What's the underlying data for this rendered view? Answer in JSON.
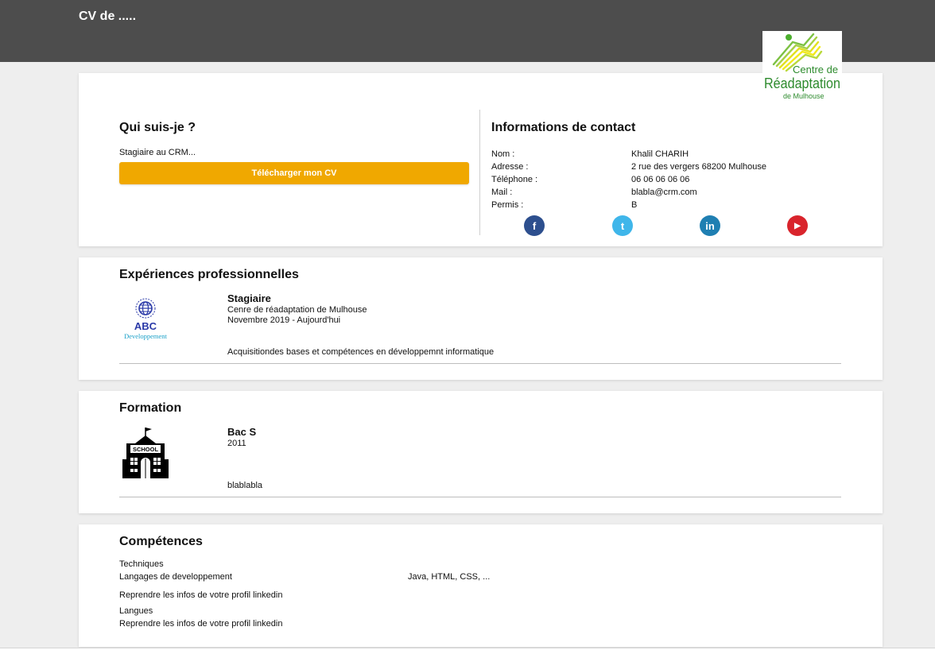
{
  "header": {
    "title": "CV de ....."
  },
  "logo": {
    "line1": "Centre de",
    "line2": "Réadaptation",
    "line3": "de Mulhouse"
  },
  "about": {
    "title": "Qui suis-je ?",
    "description": "Stagiaire au CRM...",
    "download_label": "Télécharger mon CV"
  },
  "contact": {
    "title": "Informations de contact",
    "rows": [
      {
        "label": "Nom :",
        "value": "Khalil CHARIH"
      },
      {
        "label": "Adresse :",
        "value": "2 rue des vergers 68200 Mulhouse"
      },
      {
        "label": "Téléphone :",
        "value": "06 06 06 06 06"
      },
      {
        "label": "Mail :",
        "value": "blabla@crm.com"
      },
      {
        "label": "Permis :",
        "value": "B"
      }
    ],
    "socials": [
      {
        "name": "facebook-icon",
        "glyph": "f",
        "color": "#2d4f8e"
      },
      {
        "name": "twitter-icon",
        "glyph": "t",
        "color": "#3fb6ea"
      },
      {
        "name": "linkedin-icon",
        "glyph": "in",
        "color": "#1f7fb2"
      },
      {
        "name": "youtube-icon",
        "glyph": "▶",
        "color": "#d9242c"
      }
    ]
  },
  "experience": {
    "title": "Expériences professionnelles",
    "logo_line1": "ABC",
    "logo_line2": "Developpement",
    "role": "Stagiaire",
    "company": "Cenre de réadaptation de Mulhouse",
    "period": "Novembre 2019 - Aujourd'hui",
    "description": "Acquisitiondes bases et compétences en développemnt informatique"
  },
  "formation": {
    "title": "Formation",
    "school_label": "SCHOOL",
    "degree": "Bac S",
    "year": "2011",
    "description": "blablabla"
  },
  "skills": {
    "title": "Compétences",
    "techniques_title": "Techniques",
    "techniques_label": "Langages de developpement",
    "techniques_value": "Java, HTML, CSS, ...",
    "techniques_note": "Reprendre les infos de votre profil linkedin",
    "languages_title": "Langues",
    "languages_note": "Reprendre les infos de votre profil linkedin"
  },
  "colors": {
    "topbar": "#4d4d4d",
    "accent": "#f0a800",
    "background": "#eeeeee"
  }
}
